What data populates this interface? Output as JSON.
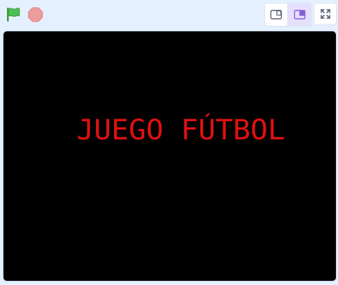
{
  "controls": {
    "green_flag_icon": "green-flag-icon",
    "stop_icon": "stop-sign-icon",
    "small_stage_icon": "small-stage-icon",
    "normal_stage_icon": "normal-stage-icon",
    "fullscreen_icon": "fullscreen-icon",
    "active_mode": "normal-stage"
  },
  "stage": {
    "title_text": "JUEGO FÚTBOL",
    "title_color": "#e01010",
    "background_color": "#000000"
  },
  "colors": {
    "flag_green": "#4cbf56",
    "stop_red": "#ec9c9c",
    "accent_purple": "#855cd6"
  }
}
